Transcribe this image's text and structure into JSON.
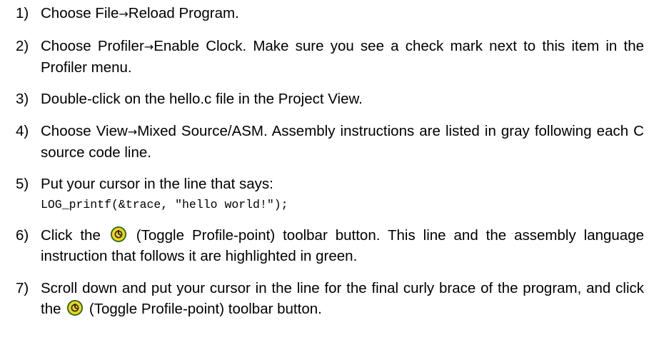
{
  "steps": [
    {
      "num": "1)",
      "parts": [
        "Choose File",
        "→",
        "Reload Program."
      ]
    },
    {
      "num": "2)",
      "parts": [
        "Choose Profiler",
        "→",
        "Enable Clock. Make sure you see a check mark next to this item in the Profiler menu."
      ]
    },
    {
      "num": "3)",
      "text": "Double-click on the hello.c file in the Project View."
    },
    {
      "num": "4)",
      "parts": [
        "Choose View",
        "→",
        "Mixed Source/ASM. Assembly instructions are listed in gray following each C source code line."
      ]
    },
    {
      "num": "5)",
      "text": "Put your cursor in the line that says:",
      "code": "LOG_printf(&trace, \"hello world!\");"
    },
    {
      "num": "6)",
      "before": "Click the",
      "after": "(Toggle Profile-point) toolbar button. This line and the assembly language instruction that follows it are highlighted in green."
    },
    {
      "num": "7)",
      "before": "Scroll down and put your cursor in the line for the final curly brace of the program, and click the",
      "after": "(Toggle Profile-point) toolbar button."
    }
  ],
  "icons": {
    "profile_point": "toggle-profile-point-icon"
  },
  "colors": {
    "icon_fill": "#f2d21a",
    "icon_dark": "#2a2a2a",
    "icon_ring": "#1d6a1d"
  }
}
